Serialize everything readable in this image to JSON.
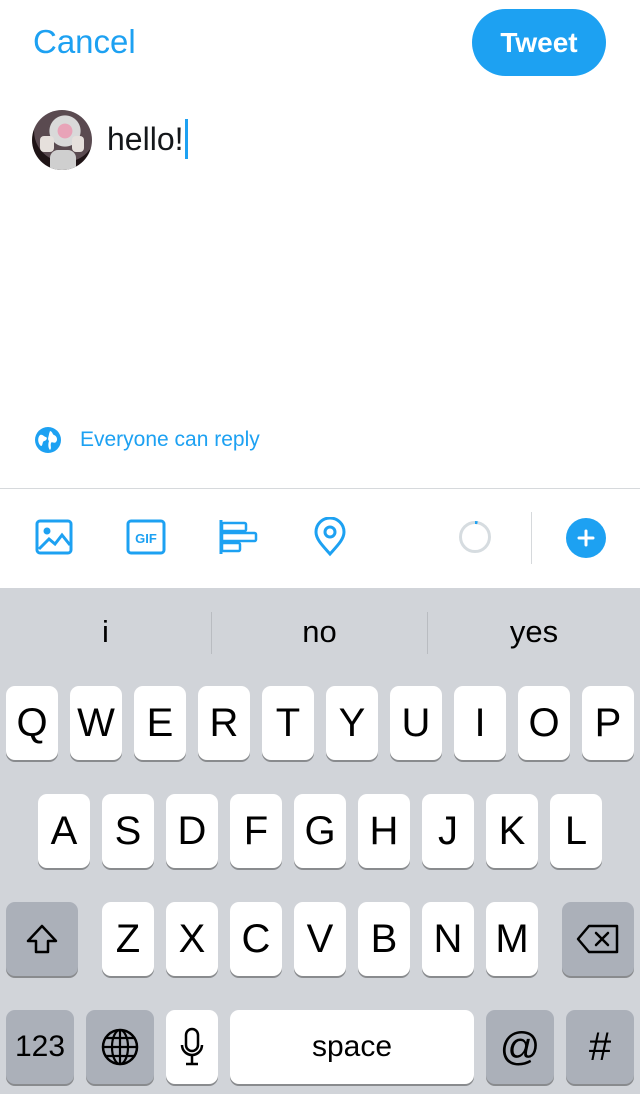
{
  "header": {
    "cancel_label": "Cancel",
    "tweet_label": "Tweet"
  },
  "compose": {
    "text": "hello!",
    "reply_setting": "Everyone can reply"
  },
  "toolbar": {
    "icons": [
      "image-icon",
      "gif-icon",
      "poll-icon",
      "location-icon",
      "progress-ring",
      "plus-icon"
    ],
    "gif_label": "GIF"
  },
  "keyboard": {
    "suggestions": [
      "i",
      "no",
      "yes"
    ],
    "row1": [
      "Q",
      "W",
      "E",
      "R",
      "T",
      "Y",
      "U",
      "I",
      "O",
      "P"
    ],
    "row2": [
      "A",
      "S",
      "D",
      "F",
      "G",
      "H",
      "J",
      "K",
      "L"
    ],
    "row3": [
      "Z",
      "X",
      "C",
      "V",
      "B",
      "N",
      "M"
    ],
    "numbers_label": "123",
    "space_label": "space",
    "at_label": "@",
    "hash_label": "#"
  },
  "colors": {
    "accent": "#1da1f2",
    "keyboard_bg": "#d1d4d9",
    "dark_key": "#abb0b9"
  }
}
